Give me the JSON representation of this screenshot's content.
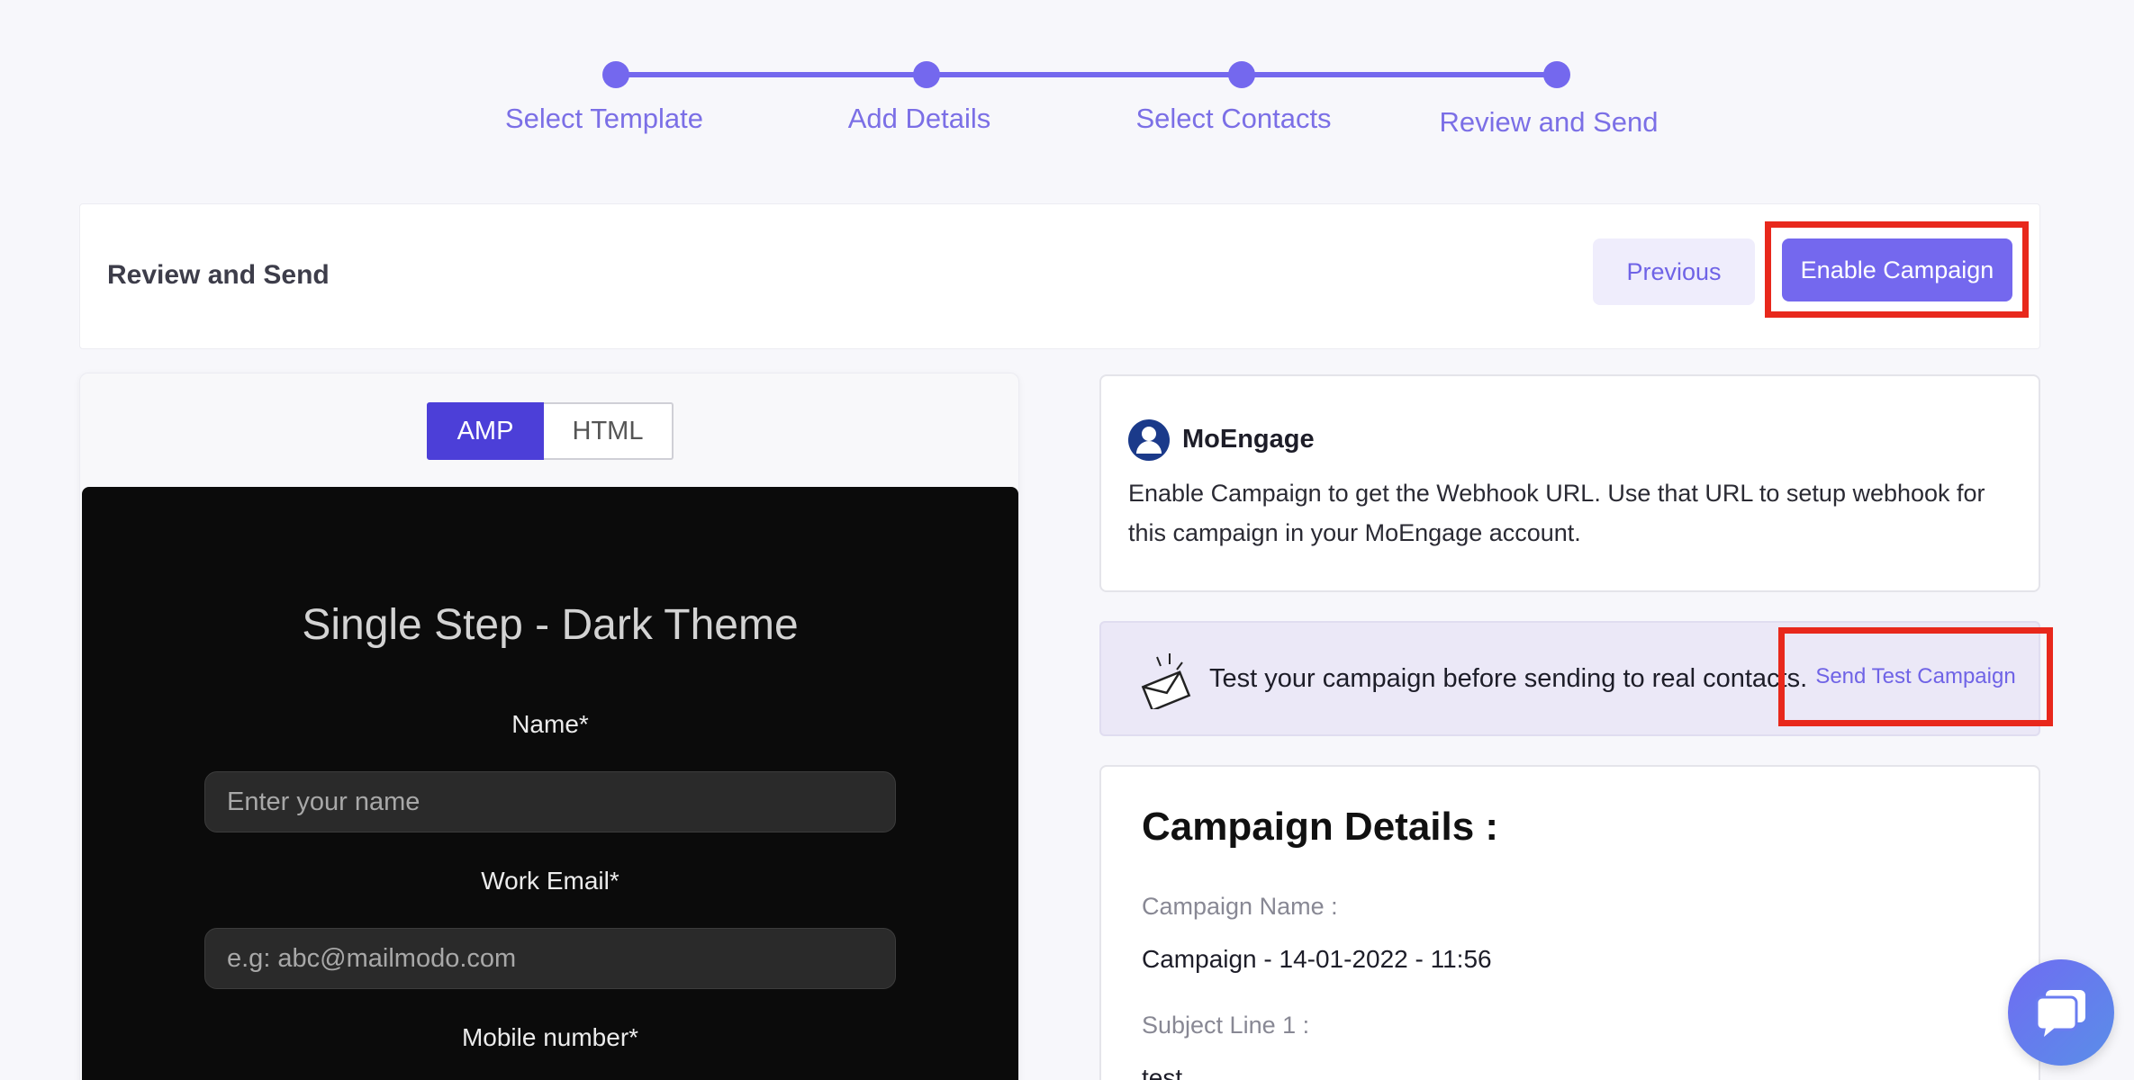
{
  "stepper": {
    "steps": [
      {
        "label": "Select Template"
      },
      {
        "label": "Add Details"
      },
      {
        "label": "Select Contacts"
      },
      {
        "label": "Review and Send"
      }
    ]
  },
  "header": {
    "title": "Review and Send",
    "previous_label": "Previous",
    "enable_label": "Enable Campaign"
  },
  "preview": {
    "tabs": [
      "AMP",
      "HTML"
    ],
    "active_tab": "AMP",
    "email": {
      "title": "Single Step - Dark Theme",
      "fields": [
        {
          "label": "Name*",
          "placeholder": "Enter your name"
        },
        {
          "label": "Work Email*",
          "placeholder": "e.g: abc@mailmodo.com"
        },
        {
          "label": "Mobile number*"
        }
      ]
    }
  },
  "moengage": {
    "name": "MoEngage",
    "description": "Enable Campaign to get the Webhook URL. Use that URL to setup webhook for this campaign in your MoEngage account."
  },
  "test_campaign": {
    "text": "Test your campaign before sending to real contacts.",
    "button_label": "Send Test Campaign"
  },
  "campaign_details": {
    "title": "Campaign Details :",
    "campaign_name_label": "Campaign Name :",
    "campaign_name_value": "Campaign - 14-01-2022 - 11:56",
    "subject_line_label": "Subject Line 1 :",
    "subject_line_value": "test"
  },
  "colors": {
    "accent": "#7468ee",
    "highlight": "#e8281c",
    "toggle_active": "#4c3fd8"
  }
}
